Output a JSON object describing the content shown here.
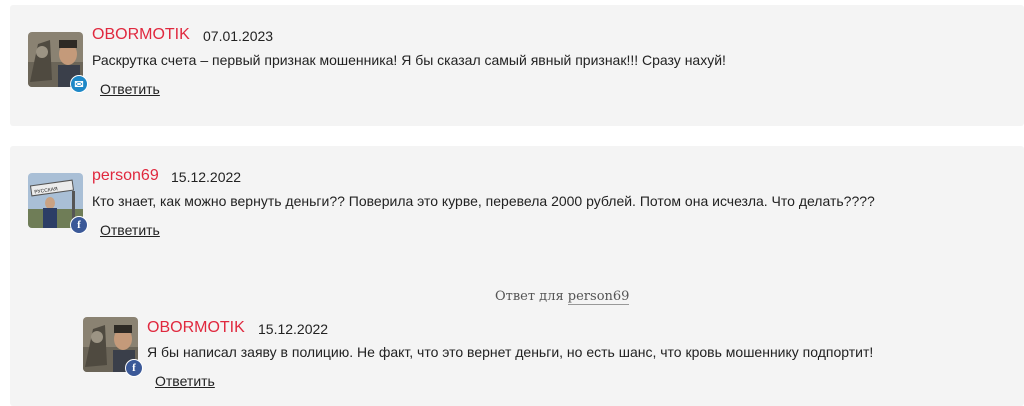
{
  "comments": [
    {
      "author": "OBORMOTIK",
      "date": "07.01.2023",
      "text": "Раскрутка счета – первый признак мошенника! Я бы сказал самый явный признак!!! Сразу нахуй!",
      "reply_label": "Ответить",
      "badge": "mail-icon"
    },
    {
      "author": "person69",
      "date": "15.12.2022",
      "text": "Кто знает, как можно вернуть деньги?? Поверила это курве, перевела 2000 рублей. Потом она исчезла. Что делать????",
      "reply_label": "Ответить",
      "badge": "facebook-icon"
    }
  ],
  "nested_reply": {
    "reply_to_prefix": "Ответ для",
    "reply_to_user": "person69",
    "author": "OBORMOTIK",
    "date": "15.12.2022",
    "text": "Я бы написал заяву в полицию. Не факт, что это вернет деньги, но есть шанс, что кровь мошеннику подпортит!",
    "reply_label": "Ответить",
    "badge": "facebook-icon"
  },
  "colors": {
    "author": "#e0283e",
    "background": "#f4f4f4",
    "mail_badge": "#1e88c7",
    "facebook_badge": "#3b5998"
  }
}
